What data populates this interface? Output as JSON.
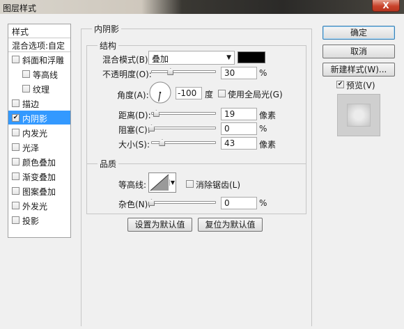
{
  "window": {
    "title": "图层样式",
    "close_label": "X"
  },
  "style_list": {
    "header": "样式",
    "blend_options": "混合选项:自定",
    "items": [
      {
        "label": "斜面和浮雕",
        "checked": false
      },
      {
        "label": "等高线",
        "checked": false
      },
      {
        "label": "纹理",
        "checked": false
      },
      {
        "label": "描边",
        "checked": false
      },
      {
        "label": "内阴影",
        "checked": true,
        "selected": true
      },
      {
        "label": "内发光",
        "checked": false
      },
      {
        "label": "光泽",
        "checked": false
      },
      {
        "label": "颜色叠加",
        "checked": false
      },
      {
        "label": "渐变叠加",
        "checked": false
      },
      {
        "label": "图案叠加",
        "checked": false
      },
      {
        "label": "外发光",
        "checked": false
      },
      {
        "label": "投影",
        "checked": false
      }
    ]
  },
  "panel": {
    "title": "内阴影",
    "structure": {
      "title": "结构",
      "blend_mode_label": "混合模式(B):",
      "blend_mode_value": "叠加",
      "shadow_color": "#000000",
      "opacity_label": "不透明度(O):",
      "opacity_value": "30",
      "opacity_unit": "%",
      "opacity_level": 0.3,
      "angle_label": "角度(A):",
      "angle_value": "-100",
      "angle_unit": "度",
      "global_light_label": "使用全局光(G)",
      "global_light_checked": false,
      "distance_label": "距离(D):",
      "distance_value": "19",
      "distance_unit": "像素",
      "distance_level": 0.075,
      "choke_label": "阻塞(C):",
      "choke_value": "0",
      "choke_unit": "%",
      "choke_level": 0.0,
      "size_label": "大小(S):",
      "size_value": "43",
      "size_unit": "像素",
      "size_level": 0.17
    },
    "quality": {
      "title": "品质",
      "contour_label": "等高线:",
      "antialias_label": "消除锯齿(L)",
      "antialias_checked": false,
      "noise_label": "杂色(N):",
      "noise_value": "0",
      "noise_unit": "%",
      "noise_level": 0.0
    },
    "set_default": "设置为默认值",
    "reset_default": "复位为默认值"
  },
  "buttons": {
    "ok": "确定",
    "cancel": "取消",
    "new_style": "新建样式(W)...",
    "preview_label": "预览(V)",
    "preview_checked": true
  }
}
